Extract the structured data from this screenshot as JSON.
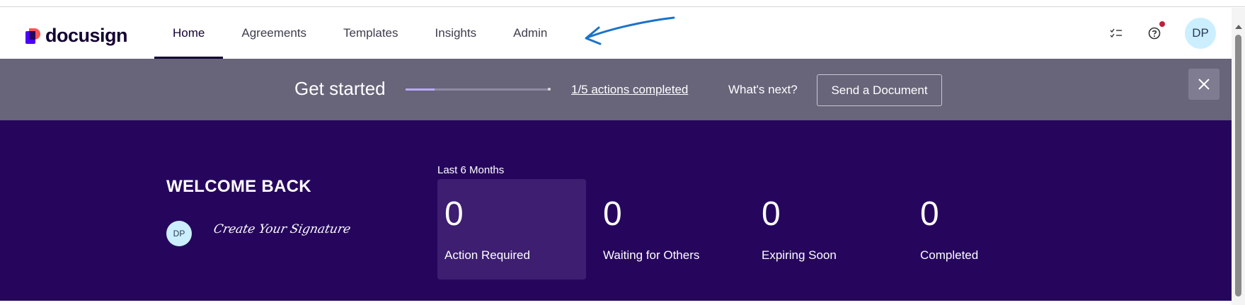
{
  "brand": {
    "name": "docusign",
    "colors": {
      "primary": "#4c00ff",
      "accent": "#ff5252",
      "dark": "#26065d",
      "banner": "#68647a"
    }
  },
  "nav": {
    "items": [
      {
        "label": "Home",
        "active": true
      },
      {
        "label": "Agreements",
        "active": false
      },
      {
        "label": "Templates",
        "active": false
      },
      {
        "label": "Insights",
        "active": false
      },
      {
        "label": "Admin",
        "active": false
      }
    ]
  },
  "header_right": {
    "icons": [
      "checklist-icon",
      "help-icon"
    ],
    "avatar_initials": "DP",
    "notification": true
  },
  "get_started": {
    "title": "Get started",
    "progress": 0.2,
    "actions_link": "1/5 actions completed",
    "whats_next": "What's next?",
    "cta_label": "Send a Document"
  },
  "welcome": {
    "title": "WELCOME BACK",
    "avatar_initials": "DP",
    "signature_text": "Create Your Signature"
  },
  "stats": {
    "period_label": "Last 6 Months",
    "items": [
      {
        "value": "0",
        "label": "Action Required"
      },
      {
        "value": "0",
        "label": "Waiting for Others"
      },
      {
        "value": "0",
        "label": "Expiring Soon"
      },
      {
        "value": "0",
        "label": "Completed"
      }
    ]
  }
}
